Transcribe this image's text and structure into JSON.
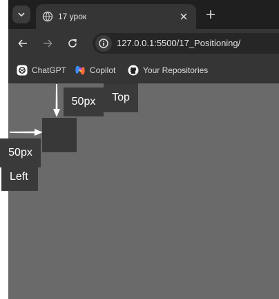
{
  "tab": {
    "title": "17 урок",
    "favicon": "globe-icon"
  },
  "toolbar": {
    "url": "127.0.0.1:5500/17_Positioning/"
  },
  "bookmarks": [
    {
      "label": "ChatGPT",
      "icon": "chatgpt-icon"
    },
    {
      "label": "Copilot",
      "icon": "copilot-icon"
    },
    {
      "label": "Your Repositories",
      "icon": "github-icon"
    }
  ],
  "page": {
    "top_value_label": "50px",
    "top_label": "Top",
    "left_value_label": "50px",
    "left_label": "Left"
  },
  "colors": {
    "page_bg": "#6a6a6a",
    "tabstrip_bg": "#1f1f1f",
    "toolbar_bg": "#353535",
    "label_bg": "#3a3a3a",
    "arrow": "#ffffff"
  }
}
